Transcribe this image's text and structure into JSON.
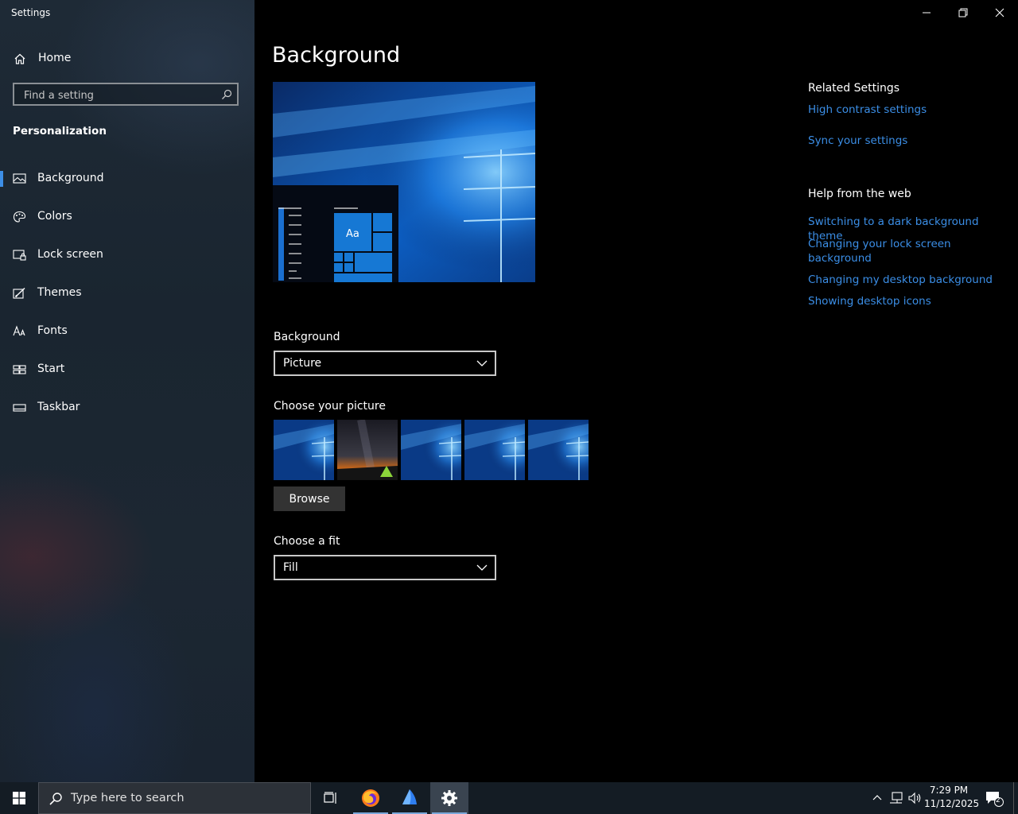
{
  "window": {
    "title": "Settings",
    "controls": [
      "minimize-icon",
      "restore-icon",
      "close-icon"
    ]
  },
  "sidebar": {
    "home_label": "Home",
    "search_placeholder": "Find a setting",
    "section_title": "Personalization",
    "items": [
      {
        "label": "Background",
        "icon": "picture-icon",
        "active": true
      },
      {
        "label": "Colors",
        "icon": "palette-icon",
        "active": false
      },
      {
        "label": "Lock screen",
        "icon": "lock-screen-icon",
        "active": false
      },
      {
        "label": "Themes",
        "icon": "brush-icon",
        "active": false
      },
      {
        "label": "Fonts",
        "icon": "font-icon",
        "active": false
      },
      {
        "label": "Start",
        "icon": "start-icon",
        "active": false
      },
      {
        "label": "Taskbar",
        "icon": "taskbar-icon",
        "active": false
      }
    ]
  },
  "main": {
    "title": "Background",
    "preview_tile_text": "Aa",
    "background_label": "Background",
    "background_value": "Picture",
    "choose_picture_label": "Choose your picture",
    "thumbnails": [
      "windows-hero-blue",
      "night-sky-tent",
      "windows-hero-blue",
      "windows-hero-blue",
      "windows-hero-blue"
    ],
    "browse_label": "Browse",
    "fit_label": "Choose a fit",
    "fit_value": "Fill"
  },
  "related": {
    "title": "Related Settings",
    "links": [
      "High contrast settings",
      "Sync your settings"
    ]
  },
  "help": {
    "title": "Help from the web",
    "links": [
      "Switching to a dark background theme",
      "Changing your lock screen background",
      "Changing my desktop background",
      "Showing desktop icons"
    ]
  },
  "taskbar": {
    "search_placeholder": "Type here to search",
    "apps": [
      "task-view-icon",
      "firefox-icon",
      "app-sail-icon",
      "settings-gear-icon"
    ],
    "time": "7:29 PM",
    "date": "11/12/2025",
    "notification_count": "2"
  },
  "colors": {
    "accent": "#3d8ee6",
    "link": "#3b8ee6",
    "taskbar": "#141c24"
  }
}
